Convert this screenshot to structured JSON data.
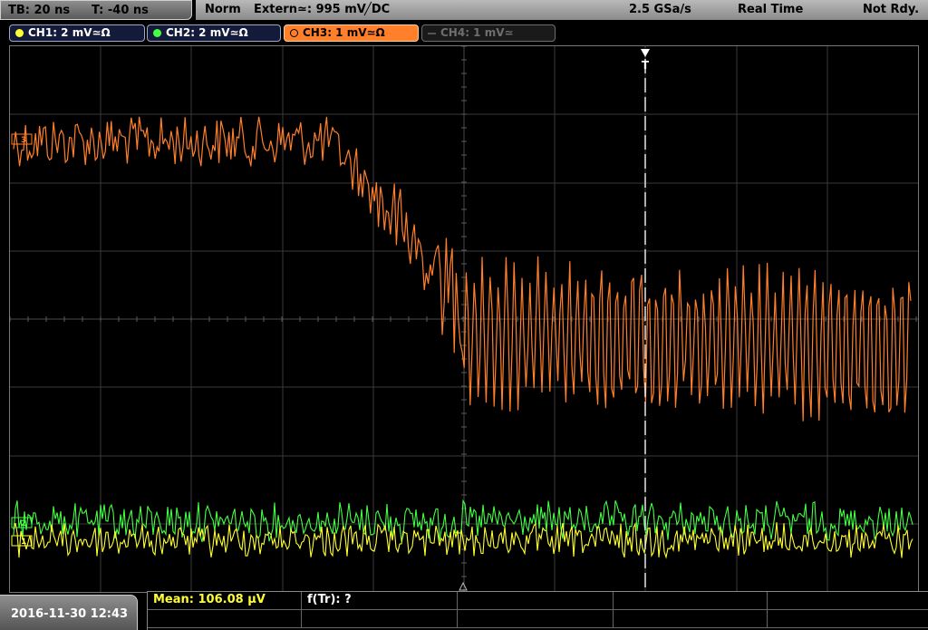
{
  "status": {
    "timebase": "TB: 20 ns",
    "trigger_time": "T: -40 ns",
    "mode": "Norm",
    "trigger_source": "Extern≃: 995 mV",
    "trigger_slope": "╱DC",
    "sample_rate": "2.5 GSa/s",
    "acquisition": "Real Time",
    "state": "Not Rdy."
  },
  "channels": [
    {
      "label": "CH1: 2 mV≃Ω",
      "color": "#ffff33",
      "active": true
    },
    {
      "label": "CH2: 2 mV≃Ω",
      "color": "#44ff44",
      "active": true
    },
    {
      "label": "CH3: 1 mV≃Ω",
      "color": "#ff7f2a",
      "active": true
    },
    {
      "label": "CH4: 1 mV≃",
      "color": "#6e6e6e",
      "active": false
    }
  ],
  "bottom": {
    "datetime": "2016-11-30 12:43",
    "measure1": "Mean: 106.08 µV",
    "measure2": "f(Tr): ?"
  },
  "markers": {
    "trigger_marker": "T",
    "ch3_marker": "3",
    "ch2_marker": "2",
    "ch1_marker": "1"
  },
  "colors": {
    "ch1": "#ffff33",
    "ch2": "#44ff44",
    "ch3": "#ff7f2a",
    "grid": "#3a3a3a"
  }
}
